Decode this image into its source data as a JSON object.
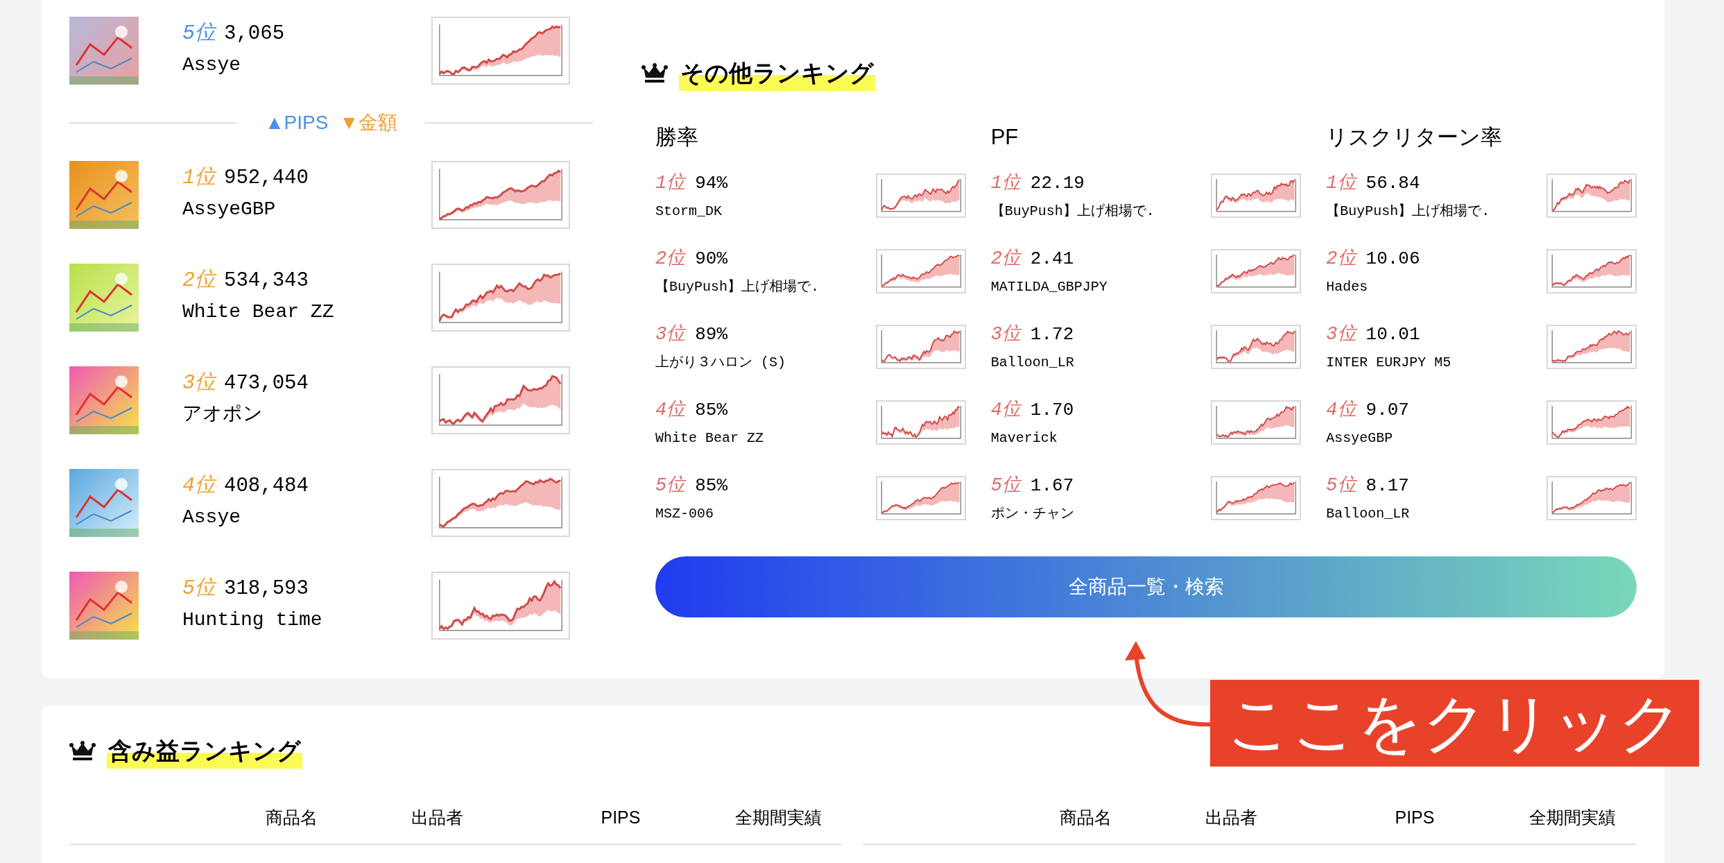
{
  "pips_ranking": {
    "kind": "pips",
    "items": [
      {
        "rank": "5位",
        "value": "3,065",
        "name": "Assye"
      }
    ]
  },
  "legend": [
    {
      "kind": "pips",
      "label": "▲PIPS"
    },
    {
      "kind": "amount",
      "label": "▼金額"
    }
  ],
  "amount_ranking": {
    "kind": "amount",
    "items": [
      {
        "rank": "1位",
        "value": "952,440",
        "name": "AssyeGBP"
      },
      {
        "rank": "2位",
        "value": "534,343",
        "name": "White Bear ZZ"
      },
      {
        "rank": "3位",
        "value": "473,054",
        "name": "アオポン"
      },
      {
        "rank": "4位",
        "value": "408,484",
        "name": "Assye"
      },
      {
        "rank": "5位",
        "value": "318,593",
        "name": "Hunting time"
      }
    ]
  },
  "other_rankings": {
    "title": "その他ランキング",
    "kind": "other",
    "columns": [
      {
        "title": "勝率",
        "items": [
          {
            "rank": "1位",
            "value": "94%",
            "name": "Storm_DK"
          },
          {
            "rank": "2位",
            "value": "90%",
            "name": "【BuyPush】上げ相場で."
          },
          {
            "rank": "3位",
            "value": "89%",
            "name": "上がり３ハロン (S)"
          },
          {
            "rank": "4位",
            "value": "85%",
            "name": "White Bear ZZ"
          },
          {
            "rank": "5位",
            "value": "85%",
            "name": "MSZ-006"
          }
        ]
      },
      {
        "title": "PF",
        "items": [
          {
            "rank": "1位",
            "value": "22.19",
            "name": "【BuyPush】上げ相場で."
          },
          {
            "rank": "2位",
            "value": "2.41",
            "name": "MATILDA_GBPJPY"
          },
          {
            "rank": "3位",
            "value": "1.72",
            "name": "Balloon_LR"
          },
          {
            "rank": "4位",
            "value": "1.70",
            "name": "Maverick"
          },
          {
            "rank": "5位",
            "value": "1.67",
            "name": "ポン・チャン"
          }
        ]
      },
      {
        "title": "リスクリターン率",
        "items": [
          {
            "rank": "1位",
            "value": "56.84",
            "name": "【BuyPush】上げ相場で."
          },
          {
            "rank": "2位",
            "value": "10.06",
            "name": "Hades"
          },
          {
            "rank": "3位",
            "value": "10.01",
            "name": "INTER EURJPY M5"
          },
          {
            "rank": "4位",
            "value": "9.07",
            "name": "AssyeGBP"
          },
          {
            "rank": "5位",
            "value": "8.17",
            "name": "Balloon_LR"
          }
        ]
      }
    ]
  },
  "all_products_button": "全商品一覧・検索",
  "unrealized_ranking": {
    "title": "含み益ランキング",
    "tables": [
      {
        "columns": [
          "商品名",
          "出品者",
          "PIPS",
          "全期間実績"
        ]
      },
      {
        "columns": [
          "商品名",
          "出品者",
          "PIPS",
          "全期間実績"
        ]
      }
    ]
  },
  "annotation": {
    "text": "ここをクリック"
  }
}
